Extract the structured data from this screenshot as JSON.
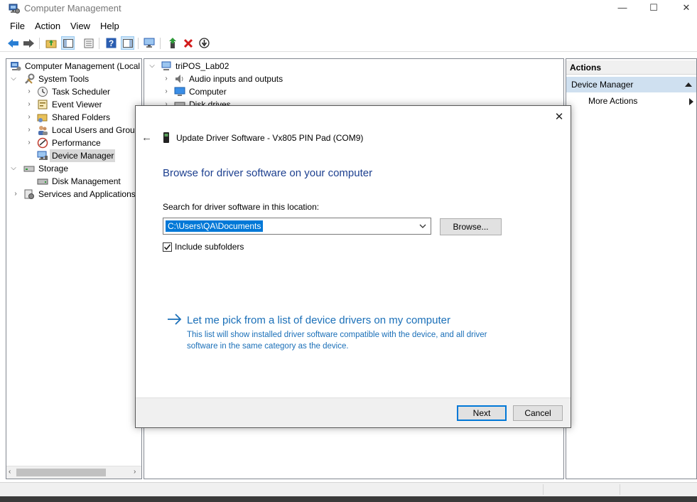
{
  "window": {
    "title": "Computer Management",
    "controls": {
      "minimize": "—",
      "maximize": "☐",
      "close": "✕"
    }
  },
  "menu": [
    "File",
    "Action",
    "View",
    "Help"
  ],
  "tree": {
    "root": "Computer Management (Local",
    "system_tools": "System Tools",
    "task_scheduler": "Task Scheduler",
    "event_viewer": "Event Viewer",
    "shared_folders": "Shared Folders",
    "local_users": "Local Users and Group",
    "performance": "Performance",
    "device_manager": "Device Manager",
    "storage": "Storage",
    "disk_management": "Disk Management",
    "services": "Services and Applications"
  },
  "devices": {
    "computer_name": "triPOS_Lab02",
    "items": [
      "Audio inputs and outputs",
      "Computer",
      "Disk drives"
    ]
  },
  "actions": {
    "header": "Actions",
    "section": "Device Manager",
    "more": "More Actions"
  },
  "dialog": {
    "title": "Update Driver Software - Vx805 PIN Pad (COM9)",
    "heading": "Browse for driver software on your computer",
    "location_label": "Search for driver software in this location:",
    "location_value": "C:\\Users\\QA\\Documents",
    "browse_button": "Browse...",
    "include_subfolders": "Include subfolders",
    "include_subfolders_checked": true,
    "pick_link": "Let me pick from a list of device drivers on my computer",
    "pick_description": "This list will show installed driver software compatible with the device, and all driver software in the same category as the device.",
    "next_button": "Next",
    "cancel_button": "Cancel",
    "close_glyph": "✕",
    "back_glyph": "←"
  },
  "colors": {
    "link": "#1a6fb8",
    "heading": "#1c3f8f",
    "selection": "#0078d7",
    "actions_section": "#cfe0f0"
  }
}
